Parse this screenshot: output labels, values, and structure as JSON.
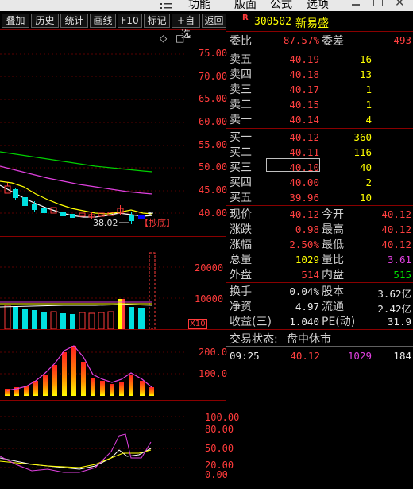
{
  "menubar": {
    "items": [
      "功能",
      "版面",
      "公式",
      "选项"
    ]
  },
  "toolbar": {
    "buttons": [
      "叠加",
      "历史",
      "统计",
      "画线",
      "F10",
      "标记",
      "+自选",
      "返回"
    ]
  },
  "stock": {
    "badge": "R",
    "code": "300502",
    "name": "新易盛"
  },
  "ratio": {
    "label_wb": "委比",
    "wb_value": "87.57%",
    "label_wc": "委差",
    "wc_value": "493"
  },
  "sell": [
    {
      "label": "卖五",
      "price": "40.19",
      "vol": "16"
    },
    {
      "label": "卖四",
      "price": "40.18",
      "vol": "13"
    },
    {
      "label": "卖三",
      "price": "40.17",
      "vol": "1"
    },
    {
      "label": "卖二",
      "price": "40.15",
      "vol": "1"
    },
    {
      "label": "卖一",
      "price": "40.14",
      "vol": "4"
    }
  ],
  "buy": [
    {
      "label": "买一",
      "price": "40.12",
      "vol": "360"
    },
    {
      "label": "买二",
      "price": "40.11",
      "vol": "116"
    },
    {
      "label": "买三",
      "price": "40.10",
      "vol": "40"
    },
    {
      "label": "买四",
      "price": "40.00",
      "vol": "2"
    },
    {
      "label": "买五",
      "price": "39.96",
      "vol": "10"
    }
  ],
  "quote": [
    {
      "l1": "现价",
      "v1": "40.12",
      "c1": "red",
      "l2": "今开",
      "v2": "40.12",
      "c2": "red"
    },
    {
      "l1": "涨跌",
      "v1": "0.98",
      "c1": "red",
      "l2": "最高",
      "v2": "40.12",
      "c2": "red"
    },
    {
      "l1": "涨幅",
      "v1": "2.50%",
      "c1": "red",
      "l2": "最低",
      "v2": "40.12",
      "c2": "red"
    },
    {
      "l1": "总量",
      "v1": "1029",
      "c1": "yel",
      "l2": "量比",
      "v2": "3.61",
      "c2": "mag"
    },
    {
      "l1": "外盘",
      "v1": "514",
      "c1": "red",
      "l2": "内盘",
      "v2": "515",
      "c2": "grn"
    }
  ],
  "fundamentals": [
    {
      "l1": "换手",
      "v1": "0.04%",
      "l2": "股本",
      "v2": "3.62亿"
    },
    {
      "l1": "净资",
      "v1": "4.97",
      "l2": "流通",
      "v2": "2.42亿"
    },
    {
      "l1": "收益(三)",
      "v1": "1.040",
      "l2": "PE(动)",
      "v2": "31.9"
    }
  ],
  "trade_status": {
    "label": "交易状态:",
    "value": "盘中休市"
  },
  "tick": {
    "time": "09:25",
    "price": "40.12",
    "vol": "1029",
    "extra": "184"
  },
  "kline": {
    "price_axis": [
      "75.00",
      "70.00",
      "65.00",
      "60.00",
      "55.00",
      "50.00",
      "45.00",
      "40.00"
    ],
    "last_low": "38.02",
    "signal": "【抄底】",
    "diamond": "◇",
    "square": "□"
  },
  "volume": {
    "axis": [
      "20000",
      "10000"
    ],
    "unit": "X10"
  },
  "ind1": {
    "axis": [
      "200.0",
      "100.0"
    ]
  },
  "ind2": {
    "axis": [
      "100.00",
      "80.00",
      "50.00",
      "20.00",
      "0.00"
    ]
  },
  "colors": {
    "up": "#ff3b3b",
    "down": "#00e0e0",
    "ma5": "#ffffff",
    "ma10": "#ffff00",
    "ma20": "#e040e0",
    "ma60": "#00e000",
    "panel_border": "#8a0000"
  }
}
